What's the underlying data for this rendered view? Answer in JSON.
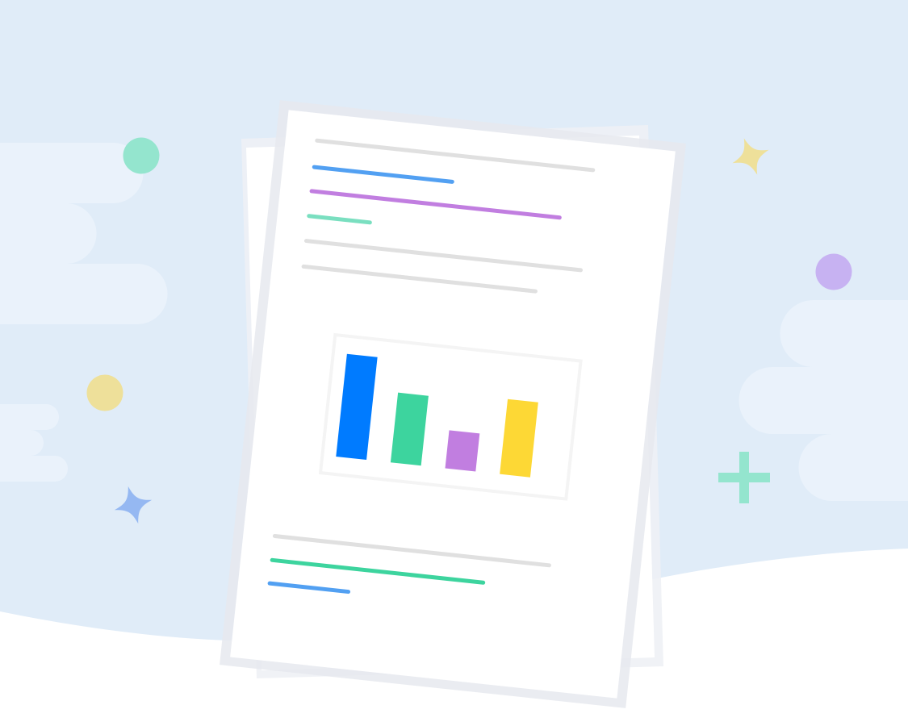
{
  "illustration": {
    "subject": "document-report",
    "colors": {
      "sky": "#E0ECF8",
      "cloud": "#EAF2FB",
      "ground": "#FFFFFF",
      "paper": "#FFFFFF",
      "paper_shadow": "#E4E9EF",
      "text_line_gray": "#E0E0E0",
      "blue": "#007BFF",
      "line_blue": "#52A0F2",
      "green": "#3DD49E",
      "line_green": "#7ADFC0",
      "purple": "#C17EE0",
      "yellow": "#FDD835",
      "dot_green": "#94E5CE",
      "dot_yellow": "#EEE09A",
      "dot_purple": "#C7B2F2",
      "sparkle_blue": "#95B8F2"
    },
    "decorations": [
      "cloud",
      "cloud",
      "dot",
      "dot",
      "dot",
      "sparkle",
      "sparkle",
      "plus-sign"
    ],
    "chart_data": {
      "type": "bar",
      "categories": [
        "",
        "",
        "",
        ""
      ],
      "values": [
        100,
        68,
        37,
        73
      ],
      "colors": [
        "#007BFF",
        "#3DD49E",
        "#C17EE0",
        "#FDD835"
      ],
      "axes": "none",
      "grid": false,
      "legend": "none"
    }
  }
}
